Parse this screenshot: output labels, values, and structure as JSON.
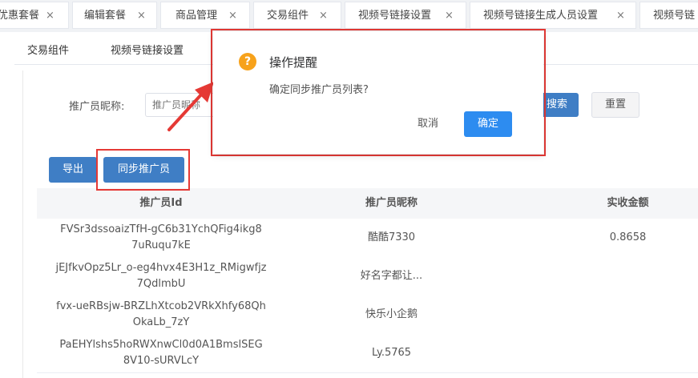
{
  "top_tabs": [
    {
      "label": "优惠套餐",
      "closable": true
    },
    {
      "label": "编辑套餐",
      "closable": true
    },
    {
      "label": "商品管理",
      "closable": true
    },
    {
      "label": "交易组件",
      "closable": true
    },
    {
      "label": "视频号链接设置",
      "closable": true
    },
    {
      "label": "视频号链接生成人员设置",
      "closable": true
    },
    {
      "label": "视频号链",
      "closable": false
    }
  ],
  "close_glyph": "×",
  "sub_tabs": [
    "交易组件",
    "视频号链接设置"
  ],
  "search": {
    "label": "推广员昵称:",
    "placeholder": "推广员昵称",
    "search_button": "搜索",
    "reset_button": "重置"
  },
  "actions": {
    "export_button": "导出",
    "sync_button": "同步推广员"
  },
  "table": {
    "columns": [
      "推广员Id",
      "推广员昵称",
      "实收金额"
    ],
    "rows": [
      {
        "id_line1": "FVSr3dssoaizTfH-gC6b31YchQFig4ikg8",
        "id_line2": "7uRuqu7kE",
        "nickname": "酷酷7330",
        "amount": "0.8658"
      },
      {
        "id_line1": "jEJfkvOpz5Lr_o-eg4hvx4E3H1z_RMigwfjz",
        "id_line2": "7QdlmbU",
        "nickname": "好名字都让...",
        "amount": ""
      },
      {
        "id_line1": "fvx-ueRBsjw-BRZLhXtcob2VRkXhfy68Qh",
        "id_line2": "OkaLb_7zY",
        "nickname": "快乐小企鹅",
        "amount": ""
      },
      {
        "id_line1": "PaEHYlshs5hoRWXnwCl0d0A1BmslSEG",
        "id_line2": "8V10-sURVLcY",
        "nickname": "Ly.5765",
        "amount": ""
      }
    ]
  },
  "modal": {
    "icon": "?",
    "title": "操作提醒",
    "message": "确定同步推广员列表?",
    "cancel_button": "取消",
    "confirm_button": "确定"
  },
  "colors": {
    "primary": "#3f7ec5",
    "confirm": "#2d8cf0",
    "warning": "#f7a21b",
    "highlight": "#e53935"
  }
}
